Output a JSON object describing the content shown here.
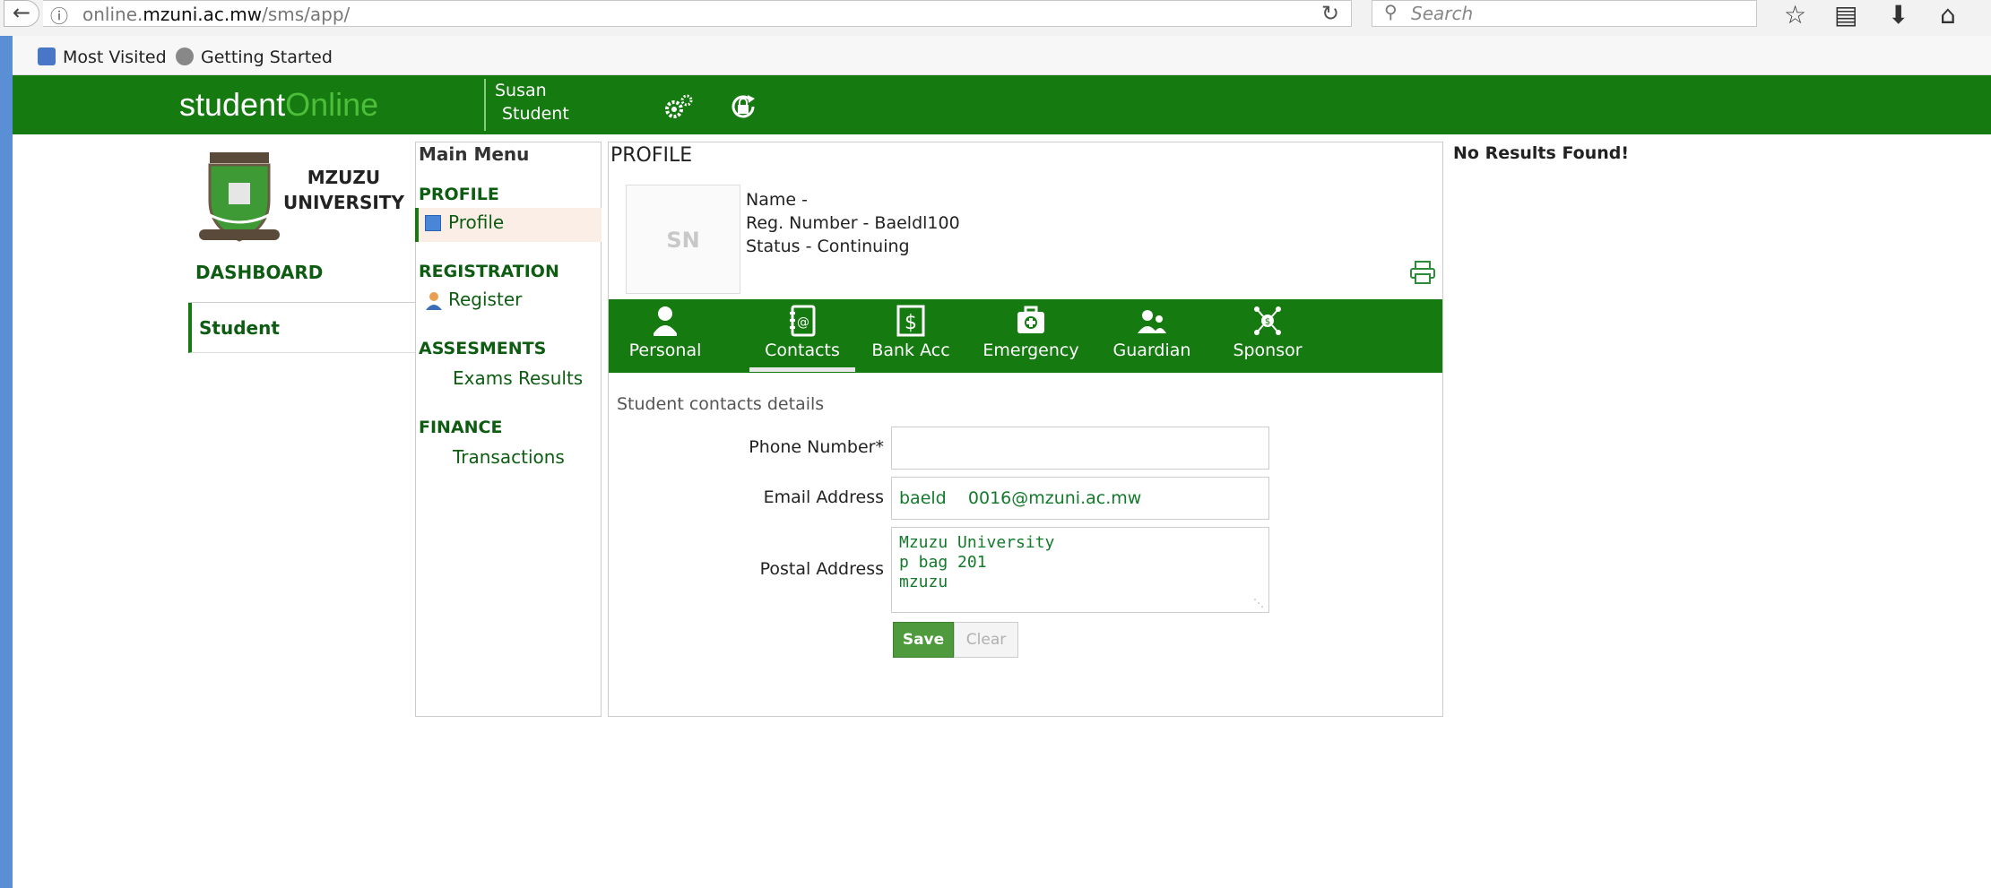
{
  "browser": {
    "url_prefix": "online.",
    "url_domain": "mzuni.ac.mw",
    "url_path": "/sms/app/",
    "search_placeholder": "Search",
    "bookmarks": [
      "Most Visited",
      "Getting Started"
    ]
  },
  "header": {
    "logo_main": "student",
    "logo_accent": "Online",
    "user_first": "Susan",
    "user_last": "Student"
  },
  "left_nav": {
    "uni_name_line1": "MZUZU",
    "uni_name_line2": "UNIVERSITY",
    "dashboard": "DASHBOARD",
    "student": "Student"
  },
  "main_menu": {
    "title": "Main Menu",
    "sections": [
      {
        "label": "PROFILE",
        "items": [
          "Profile"
        ]
      },
      {
        "label": "REGISTRATION",
        "items": [
          "Register"
        ]
      },
      {
        "label": "ASSESMENTS",
        "items": [
          "Exams Results"
        ]
      },
      {
        "label": "FINANCE",
        "items": [
          "Transactions"
        ]
      }
    ]
  },
  "profile": {
    "title": "PROFILE",
    "avatar_initials": "SN",
    "name_line": "Name -",
    "reg_line": "Reg. Number - Baeldl100",
    "status_line": "Status - Continuing",
    "tabs": [
      "Personal",
      "Contacts",
      "Bank Acc",
      "Emergency",
      "Guardian",
      "Sponsor"
    ],
    "section_caption": "Student contacts details",
    "fields": {
      "phone_label": "Phone Number*",
      "phone_value": "",
      "email_label": "Email Address",
      "email_value": "baeld    0016@mzuni.ac.mw",
      "postal_label": "Postal Address",
      "postal_value": "Mzuzu University\np bag 201\nmzuzu"
    },
    "save_label": "Save",
    "clear_label": "Clear"
  },
  "results": {
    "message": "No Results Found!"
  },
  "colors": {
    "brand_green": "#157a0f",
    "accent_green": "#4dbe3a",
    "link_green": "#0d5c12"
  }
}
